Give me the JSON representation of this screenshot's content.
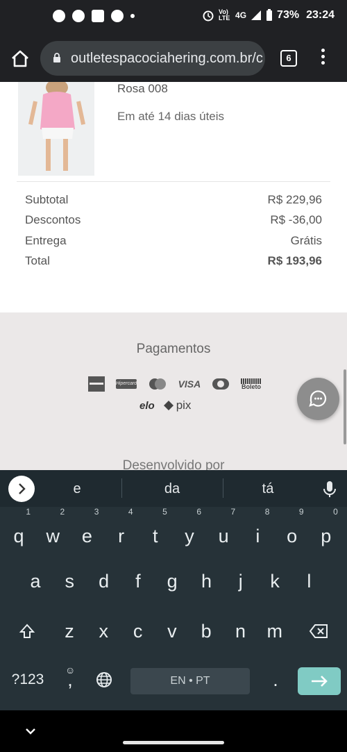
{
  "status": {
    "battery": "73%",
    "time": "23:24",
    "signal": "4G",
    "lte": "Vo) LTE"
  },
  "browser": {
    "url": "outletespacociahering.com.br/c",
    "tabs": "6"
  },
  "product": {
    "name": "Rosa 008",
    "delivery": "Em até 14 dias úteis"
  },
  "summary": {
    "rows": [
      {
        "label": "Subtotal",
        "value": "R$ 229,96"
      },
      {
        "label": "Descontos",
        "value": "R$ -36,00"
      },
      {
        "label": "Entrega",
        "value": "Grátis"
      },
      {
        "label": "Total",
        "value": "R$ 193,96"
      }
    ]
  },
  "footer": {
    "payments_title": "Pagamentos",
    "payment_logos": [
      "Hipercard",
      "VISA",
      "Boleto",
      "elo",
      "pix"
    ],
    "developed_by": "Desenvolvido por"
  },
  "keyboard": {
    "suggestions": [
      "e",
      "da",
      "tá"
    ],
    "row1": [
      [
        "q",
        "1"
      ],
      [
        "w",
        "2"
      ],
      [
        "e",
        "3"
      ],
      [
        "r",
        "4"
      ],
      [
        "t",
        "5"
      ],
      [
        "y",
        "6"
      ],
      [
        "u",
        "7"
      ],
      [
        "i",
        "8"
      ],
      [
        "o",
        "9"
      ],
      [
        "p",
        "0"
      ]
    ],
    "row2": [
      "a",
      "s",
      "d",
      "f",
      "g",
      "h",
      "j",
      "k",
      "l"
    ],
    "row3": [
      "z",
      "x",
      "c",
      "v",
      "b",
      "n",
      "m"
    ],
    "sym_label": "?123",
    "comma": ",",
    "period": ".",
    "space_label": "EN • PT"
  },
  "colors": {
    "accent_key": "#80cbc4",
    "keyboard_bg": "#263238",
    "footer_bg": "#ebe8e8"
  }
}
